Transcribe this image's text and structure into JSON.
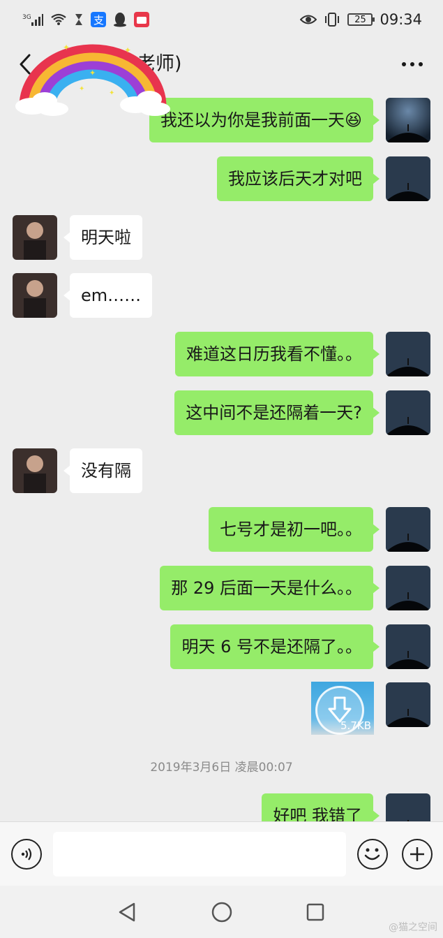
{
  "status_bar": {
    "network": "3G",
    "battery": "25",
    "time": "09:34"
  },
  "header": {
    "title": "老师)"
  },
  "messages": [
    {
      "side": "out",
      "text": "我还以为你是我前面一天😆"
    },
    {
      "side": "out",
      "text": "我应该后天才对吧"
    },
    {
      "side": "in",
      "text": "明天啦"
    },
    {
      "side": "in",
      "text": "em……"
    },
    {
      "side": "out",
      "text": "难道这日历我看不懂。。"
    },
    {
      "side": "out",
      "text": "这中间不是还隔着一天?"
    },
    {
      "side": "in",
      "text": "没有隔"
    },
    {
      "side": "out",
      "text": "七号才是初一吧。。"
    },
    {
      "side": "out",
      "text": "那 29 后面一天是什么。。"
    },
    {
      "side": "out",
      "text": "明天 6 号不是还隔了。。"
    }
  ],
  "file_message": {
    "size": "5.7KB"
  },
  "timestamp": "2019年3月6日 凌晨00:07",
  "last_message": {
    "side": "out",
    "text": "好吧 我错了"
  },
  "input": {
    "placeholder": ""
  },
  "watermark": "@猫之空间",
  "colors": {
    "bubble_out": "#95ec69",
    "bubble_in": "#ffffff",
    "background": "#ededed"
  }
}
